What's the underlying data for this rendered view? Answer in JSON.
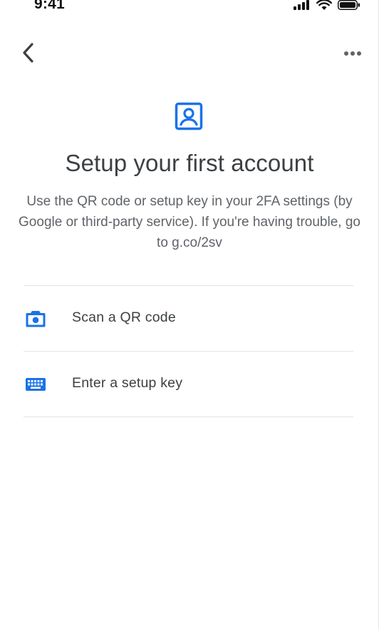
{
  "status_bar": {
    "time": "9:41",
    "icons": [
      "signal-icon",
      "wifi-icon",
      "battery-icon"
    ]
  },
  "nav": {
    "back_icon": "chevron-left-icon",
    "more_icon": "more-horizontal-icon"
  },
  "header": {
    "icon": "account-box-icon",
    "title": "Setup your first account",
    "description": "Use the QR code or setup key in your 2FA settings (by Google or third-party service). If you're having trouble, go to g.co/2sv"
  },
  "options": [
    {
      "icon": "camera-icon",
      "label": "Scan a QR code"
    },
    {
      "icon": "keyboard-icon",
      "label": "Enter a setup key"
    }
  ],
  "colors": {
    "accent": "#1a73e8",
    "title_text": "#3c4043",
    "body_text": "#5f6368",
    "divider": "#e3e3e3"
  }
}
